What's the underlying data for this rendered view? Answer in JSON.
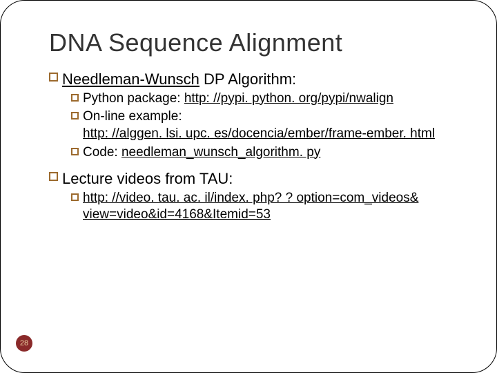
{
  "title": "DNA Sequence Alignment",
  "items": {
    "nw": {
      "link": "Needleman-Wunsch",
      "rest": " DP Algorithm:"
    },
    "python": {
      "pre": "Python package: ",
      "url": "http: //pypi. python. org/pypi/nwalign"
    },
    "online": {
      "pre": "On-line example: ",
      "url": "http: //alggen. lsi. upc. es/docencia/ember/frame-ember. html"
    },
    "code": {
      "pre": "Code: ",
      "url": "needleman_wunsch_algorithm. py"
    },
    "lecture": "Lecture videos from TAU:",
    "video": "http: //video. tau. ac. il/index. php? ? option=com_videos& view=video&id=4168&Itemid=53"
  },
  "page": "28"
}
